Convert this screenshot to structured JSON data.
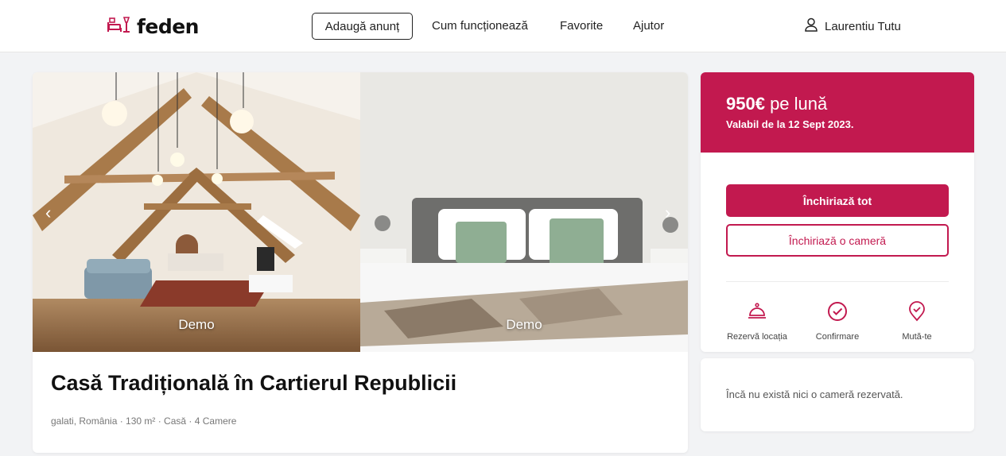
{
  "brand": {
    "name": "feden",
    "color": "#c2194f"
  },
  "header": {
    "add_listing": "Adaugă anunț",
    "nav": [
      "Cum funcționează",
      "Favorite",
      "Ajutor"
    ],
    "user_name": "Laurentiu Tutu"
  },
  "listing": {
    "photos": [
      {
        "caption": "Demo",
        "subject": "attic living room with wooden beams"
      },
      {
        "caption": "Demo",
        "subject": "bedroom with grey headboard"
      }
    ],
    "prev_arrow": "‹",
    "next_arrow": "›",
    "title": "Casă Tradițională în Cartierul Republicii",
    "meta": "galati, România · 130 m² · Casă · 4 Camere"
  },
  "pricing": {
    "price": "950€",
    "period": " pe lună",
    "valid": "Valabil de la 12 Sept 2023.",
    "rent_all": "Închiriază tot",
    "rent_room": "Închiriază o cameră",
    "features": [
      {
        "label": "Rezervă locația",
        "icon": "reception-bell-icon"
      },
      {
        "label": "Confirmare",
        "icon": "check-circle-icon"
      },
      {
        "label": "Mută-te",
        "icon": "location-check-icon"
      }
    ]
  },
  "rooms": {
    "empty_text": "Încă nu există nici o cameră rezervată."
  }
}
